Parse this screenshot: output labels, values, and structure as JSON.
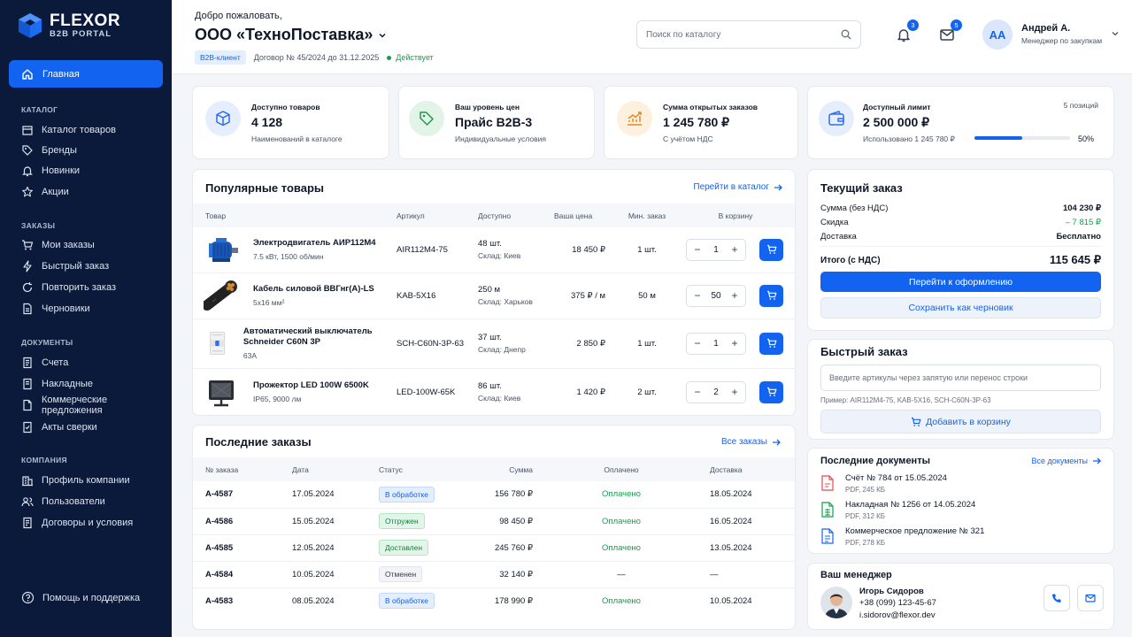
{
  "brand": {
    "name": "FLEXOR",
    "sub": "B2B PORTAL"
  },
  "nav": {
    "home": "Главная",
    "sections": [
      {
        "title": "КАТАЛОГ",
        "items": [
          "Каталог товаров",
          "Бренды",
          "Новинки",
          "Акции"
        ]
      },
      {
        "title": "ЗАКАЗЫ",
        "items": [
          "Мои заказы",
          "Быстрый заказ",
          "Повторить заказ",
          "Черновики"
        ]
      },
      {
        "title": "ДОКУМЕНТЫ",
        "items": [
          "Счета",
          "Накладные",
          "Коммерческие предложения",
          "Акты сверки"
        ]
      },
      {
        "title": "КОМПАНИЯ",
        "items": [
          "Профиль компании",
          "Пользователи",
          "Договоры и условия"
        ]
      }
    ],
    "help": "Помощь и поддержка"
  },
  "header": {
    "welcome": "Добро пожаловать,",
    "company": "ООО «ТехноПоставка»",
    "badge": "B2B-клиент",
    "contract": "Договор № 45/2024 до 31.12.2025",
    "status": "Действует",
    "search_placeholder": "Поиск по каталогу",
    "notifications_count": "3",
    "messages_count": "5",
    "user_initials": "АА",
    "user_name": "Андрей А.",
    "user_role": "Менеджер по закупкам"
  },
  "kpis": [
    {
      "label": "Доступно товаров",
      "value": "4 128",
      "sub": "Наименований в каталоге"
    },
    {
      "label": "Ваш уровень цен",
      "value": "Прайс B2B-3",
      "sub": "Индивидуальные условия"
    },
    {
      "label": "Сумма открытых заказов",
      "value": "1 245 780 ₽",
      "sub": "С учётом НДС"
    },
    {
      "label": "Доступный лимит",
      "value": "2 500 000 ₽",
      "sub": "Использовано 1 245 780 ₽",
      "positions": "5 позиций",
      "progress": 0.5,
      "progress_label": "50%"
    }
  ],
  "popular": {
    "title": "Популярные товары",
    "link": "Перейти в каталог",
    "columns": [
      "Товар",
      "Артикул",
      "Доступно",
      "Ваша цена",
      "Мин. заказ",
      "В корзину"
    ],
    "rows": [
      {
        "name": "Электродвигатель АИР112М4",
        "spec": "7.5 кВт, 1500 об/мин",
        "sku": "AIR112M4-75",
        "stock": "48 шт.",
        "warehouse": "Склад: Киев",
        "price": "18 450 ₽",
        "min": "1 шт.",
        "qty": "1"
      },
      {
        "name": "Кабель силовой ВВГнг(А)-LS",
        "spec": "5х16 мм²",
        "sku": "KAB-5X16",
        "stock": "250 м",
        "warehouse": "Склад: Харьков",
        "price": "375 ₽ / м",
        "min": "50 м",
        "qty": "50"
      },
      {
        "name": "Автоматический выключатель Schneider C60N 3P",
        "spec": "63А",
        "sku": "SCH-C60N-3P-63",
        "stock": "37 шт.",
        "warehouse": "Склад: Днепр",
        "price": "2 850 ₽",
        "min": "1 шт.",
        "qty": "1"
      },
      {
        "name": "Прожектор LED 100W 6500K",
        "spec": "IP65, 9000 лм",
        "sku": "LED-100W-65K",
        "stock": "86 шт.",
        "warehouse": "Склад: Киев",
        "price": "1 420 ₽",
        "min": "2 шт.",
        "qty": "2"
      }
    ]
  },
  "orders": {
    "title": "Последние заказы",
    "link": "Все заказы",
    "columns": [
      "№ заказа",
      "Дата",
      "Статус",
      "Сумма",
      "Оплачено",
      "Доставка"
    ],
    "rows": [
      {
        "id": "A-4587",
        "date": "17.05.2024",
        "status": "В обработке",
        "status_type": "proc",
        "sum": "156 780 ₽",
        "paid": "Оплачено",
        "delivery": "18.05.2024"
      },
      {
        "id": "A-4586",
        "date": "15.05.2024",
        "status": "Отгружен",
        "status_type": "ship",
        "sum": "98 450 ₽",
        "paid": "Оплачено",
        "delivery": "16.05.2024"
      },
      {
        "id": "A-4585",
        "date": "12.05.2024",
        "status": "Доставлен",
        "status_type": "del",
        "sum": "245 760 ₽",
        "paid": "Оплачено",
        "delivery": "13.05.2024"
      },
      {
        "id": "A-4584",
        "date": "10.05.2024",
        "status": "Отменен",
        "status_type": "can",
        "sum": "32 140 ₽",
        "paid": "—",
        "delivery": "—"
      },
      {
        "id": "A-4583",
        "date": "08.05.2024",
        "status": "В обработке",
        "status_type": "proc",
        "sum": "178 990 ₽",
        "paid": "Оплачено",
        "delivery": "10.05.2024"
      }
    ]
  },
  "current_order": {
    "title": "Текущий заказ",
    "lines": [
      {
        "label": "Сумма (без НДС)",
        "value": "104 230 ₽"
      },
      {
        "label": "Скидка",
        "value": "– 7 815 ₽"
      },
      {
        "label": "Доставка",
        "value": "Бесплатно"
      }
    ],
    "total_label": "Итого (с НДС)",
    "total_value": "115 645 ₽",
    "checkout": "Перейти к оформлению",
    "save_draft": "Сохранить как черновик"
  },
  "quick_order": {
    "title": "Быстрый заказ",
    "placeholder": "Введите артикулы через запятую или перенос строки",
    "example": "Пример: AIR112M4-75, KAB-5X16, SCH-C60N-3P-63",
    "add": "Добавить в корзину"
  },
  "documents": {
    "title": "Последние документы",
    "link": "Все документы",
    "items": [
      {
        "title": "Счёт № 784 от 15.05.2024",
        "meta": "PDF, 245 КБ",
        "color": "#e5484d"
      },
      {
        "title": "Накладная № 1256 от 14.05.2024",
        "meta": "PDF, 312 КБ",
        "color": "#12a14b"
      },
      {
        "title": "Коммерческое предложение № 321",
        "meta": "PDF, 278 КБ",
        "color": "#1264f0"
      }
    ]
  },
  "manager": {
    "title": "Ваш менеджер",
    "name": "Игорь Сидоров",
    "phone": "+38 (099) 123-45-67",
    "email": "i.sidorov@flexor.dev"
  },
  "colors": {
    "accent": "#1264f0",
    "sidebar": "#0b1a3a",
    "success": "#12a14b",
    "danger": "#e5484d"
  }
}
